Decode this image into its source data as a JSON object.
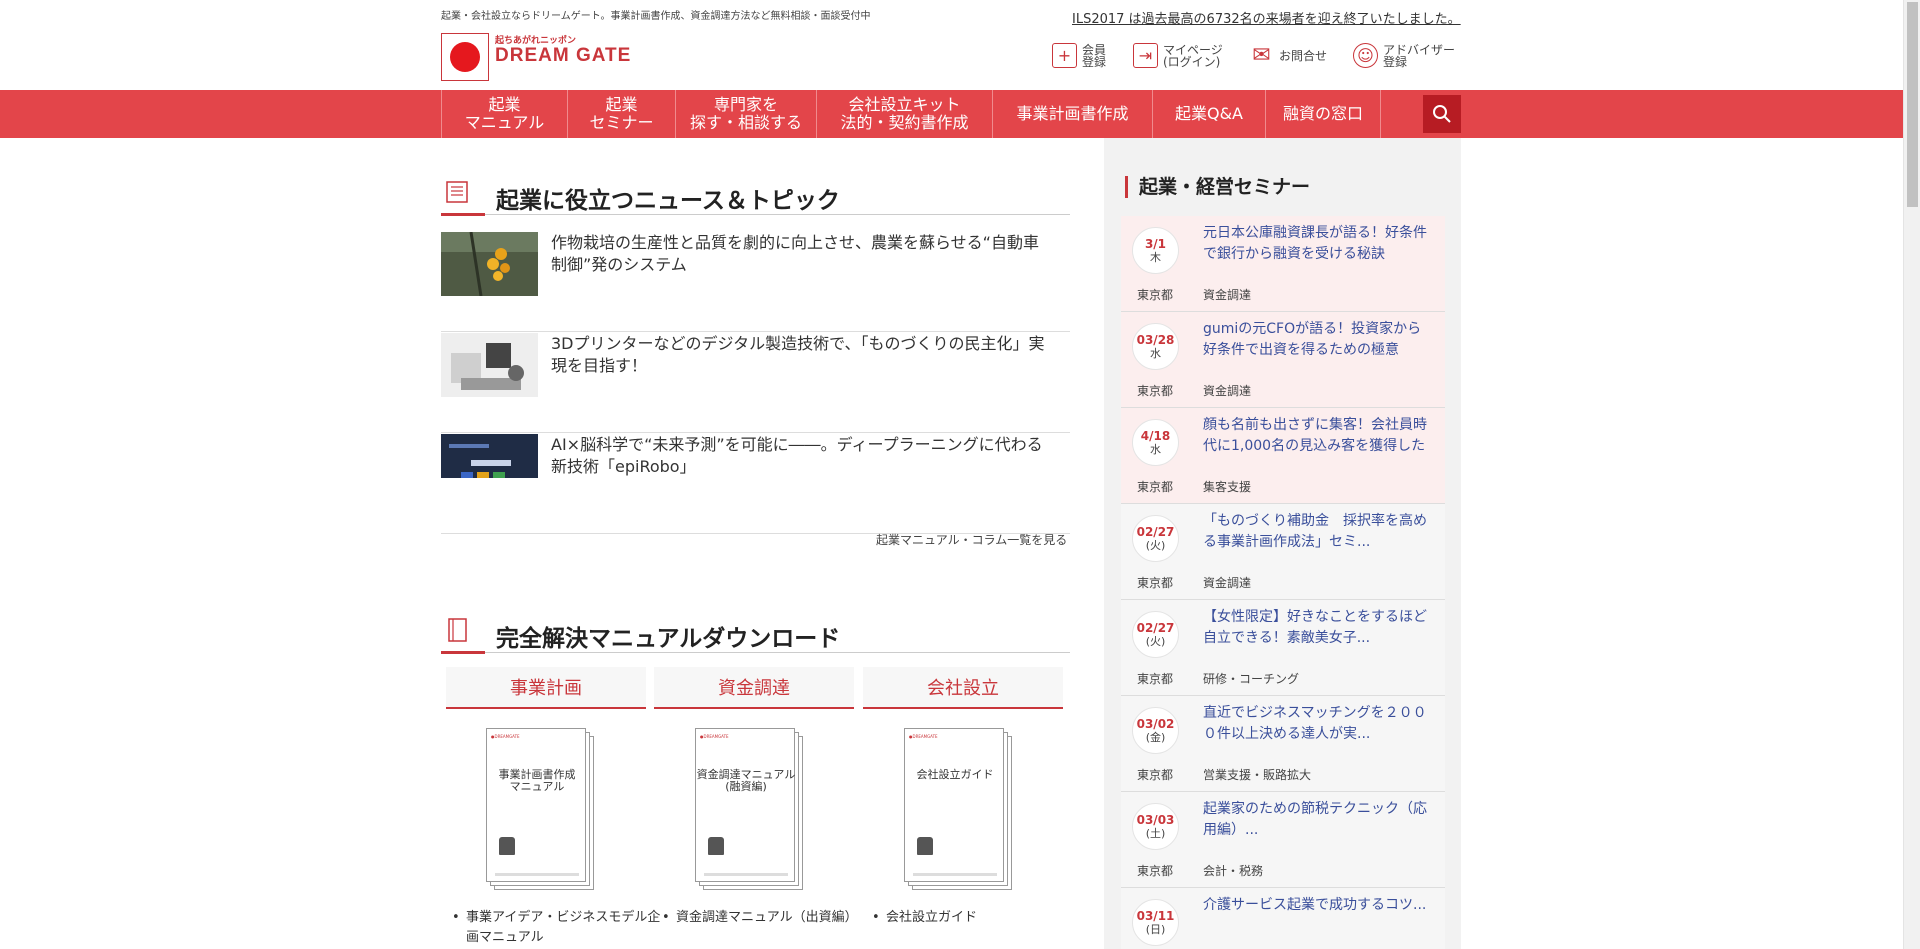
{
  "header": {
    "tagline": "起業・会社設立ならドリームゲート。事業計画書作成、資金調達方法など無料相談・面談受付中",
    "announcement": "ILS2017 は過去最高の6732名の来場者を迎え終了いたしました。",
    "logo_tagline": "起ちあがれニッポン",
    "logo_text": "DREAM GATE",
    "links": [
      {
        "label": "会員\n登録",
        "icon": "plus-icon"
      },
      {
        "label": "マイページ\n(ログイン)",
        "icon": "login-arrow-icon"
      },
      {
        "label": "お問合せ",
        "icon": "mail-icon"
      },
      {
        "label": "アドバイザー\n登録",
        "icon": "advisor-icon"
      }
    ]
  },
  "nav": {
    "items": [
      "起業\nマニュアル",
      "起業\nセミナー",
      "専門家を\n探す・相談する",
      "会社設立キット\n法的・契約書作成",
      "事業計画書作成",
      "起業Q&A",
      "融資の窓口"
    ],
    "search_icon": "search-icon"
  },
  "news": {
    "title": "起業に役立つニュース＆トピック",
    "items": [
      {
        "title": "作物栽培の生産性と品質を劇的に向上させ、農業を蘇らせる“自動車制御”発のシステム"
      },
      {
        "title": "3Dプリンターなどのデジタル製造技術で、「ものづくりの民主化」実現を目指す！"
      },
      {
        "title": "AI×脳科学で“未来予測”を可能に――。ディープラーニングに代わる新技術「epiRobo」"
      }
    ],
    "more": "起業マニュアル・コラム一覧を見る"
  },
  "downloads": {
    "title": "完全解決マニュアルダウンロード",
    "tabs": [
      "事業計画",
      "資金調達",
      "会社設立"
    ],
    "booklets": [
      {
        "title": "事業計画書作成\nマニュアル"
      },
      {
        "title": "資金調達マニュアル\n(融資編)"
      },
      {
        "title": "会社設立ガイド"
      }
    ],
    "lists": [
      [
        "事業アイデア・ビジネスモデル企画マニュアル"
      ],
      [
        "資金調達マニュアル（出資編）"
      ],
      [
        "会社設立ガイド"
      ]
    ]
  },
  "sidebar": {
    "title": "起業・経営セミナー",
    "seminars": [
      {
        "date": "3/1",
        "weekday": "木",
        "title": "元日本公庫融資課長が語る！好条件で銀行から融資を受ける秘訣",
        "location": "東京都",
        "category": "資金調達",
        "style": "pink"
      },
      {
        "date": "03/28",
        "weekday": "水",
        "title": "gumiの元CFOが語る！投資家から好条件で出資を得るための極意",
        "location": "東京都",
        "category": "資金調達",
        "style": "pink"
      },
      {
        "date": "4/18",
        "weekday": "水",
        "title": "顔も名前も出さずに集客！会社員時代に1,000名の見込み客を獲得した",
        "location": "東京都",
        "category": "集客支援",
        "style": "pink"
      },
      {
        "date": "02/27",
        "weekday": "(火)",
        "title": "「ものづくり補助金　採択率を高める事業計画作成法」セミ...",
        "location": "東京都",
        "category": "資金調達",
        "style": "plain"
      },
      {
        "date": "02/27",
        "weekday": "(火)",
        "title": "【女性限定】好きなことをするほど自立できる！素敵美女子...",
        "location": "東京都",
        "category": "研修・コーチング",
        "style": "plain"
      },
      {
        "date": "03/02",
        "weekday": "(金)",
        "title": "直近でビジネスマッチングを２０００件以上決める達人が実...",
        "location": "東京都",
        "category": "営業支援・販路拡大",
        "style": "plain"
      },
      {
        "date": "03/03",
        "weekday": "(土)",
        "title": "起業家のための節税テクニック（応用編）...",
        "location": "東京都",
        "category": "会計・税務",
        "style": "plain"
      },
      {
        "date": "03/11",
        "weekday": "(日)",
        "title": "介護サービス起業で成功するコツ...",
        "location": "",
        "category": "",
        "style": "plain"
      }
    ]
  },
  "colors": {
    "brand_red": "#e3454a",
    "dark_red": "#b71c23",
    "link_blue": "#3a4f9b"
  }
}
